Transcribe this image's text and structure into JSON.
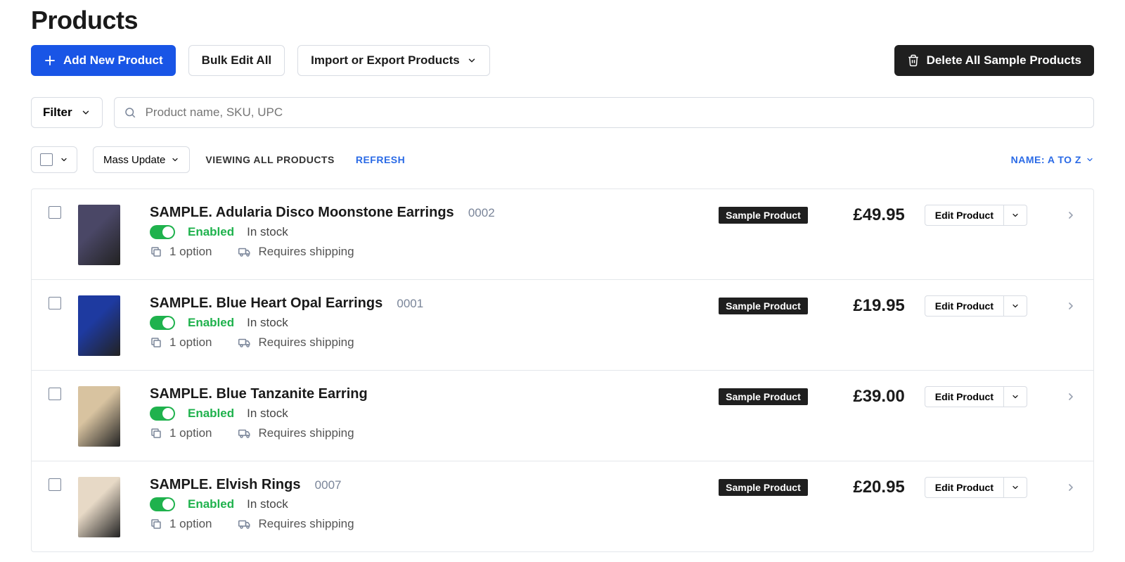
{
  "page": {
    "title": "Products",
    "add_btn": "Add New Product",
    "bulk_btn": "Bulk Edit All",
    "import_btn": "Import or Export Products",
    "delete_btn": "Delete All Sample Products",
    "filter_label": "Filter",
    "search_placeholder": "Product name, SKU, UPC",
    "mass_update": "Mass Update",
    "viewing": "VIEWING ALL PRODUCTS",
    "refresh": "REFRESH",
    "sort": "NAME: A TO Z"
  },
  "labels": {
    "enabled": "Enabled",
    "in_stock": "In stock",
    "option": "1 option",
    "shipping": "Requires shipping",
    "sample_badge": "Sample Product",
    "edit": "Edit Product"
  },
  "currency": "£",
  "thumb_colors": [
    "#4a4766",
    "#1e3aa0",
    "#d8c3a0",
    "#e7d9c6"
  ],
  "products": [
    {
      "name": "SAMPLE. Adularia Disco Moonstone Earrings",
      "sku": "0002",
      "price": "49.95"
    },
    {
      "name": "SAMPLE. Blue Heart Opal Earrings",
      "sku": "0001",
      "price": "19.95"
    },
    {
      "name": "SAMPLE. Blue Tanzanite Earring",
      "sku": "",
      "price": "39.00"
    },
    {
      "name": "SAMPLE. Elvish Rings",
      "sku": "0007",
      "price": "20.95"
    }
  ]
}
